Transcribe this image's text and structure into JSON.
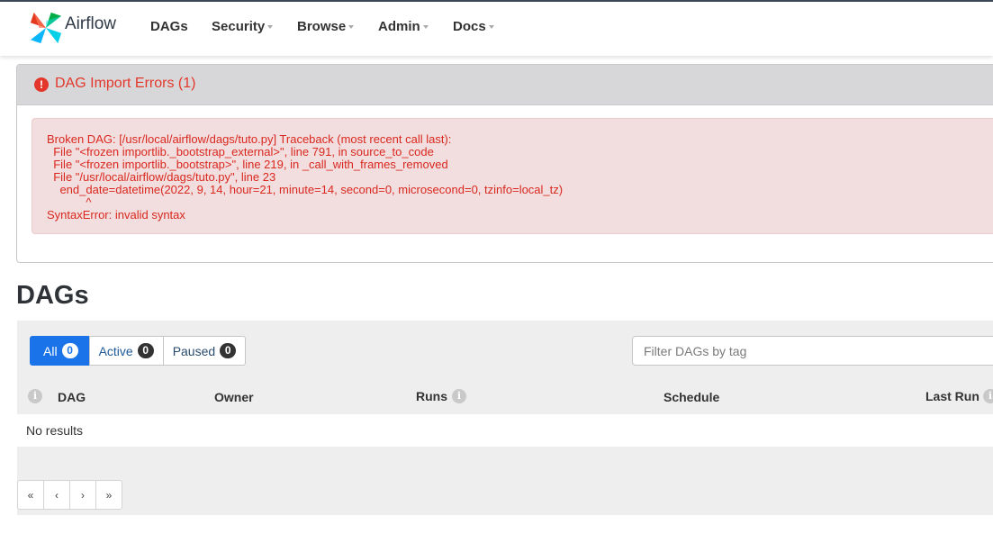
{
  "brand": {
    "name": "Airflow"
  },
  "nav": {
    "dags": "DAGs",
    "security": "Security",
    "browse": "Browse",
    "admin": "Admin",
    "docs": "Docs"
  },
  "import_errors": {
    "title": "DAG Import Errors (1)",
    "badge": "!",
    "message": "Broken DAG: [/usr/local/airflow/dags/tuto.py] Traceback (most recent call last):\n  File \"<frozen importlib._bootstrap_external>\", line 791, in source_to_code\n  File \"<frozen importlib._bootstrap>\", line 219, in _call_with_frames_removed\n  File \"/usr/local/airflow/dags/tuto.py\", line 23\n    end_date=datetime(2022, 9, 14, hour=21, minute=14, second=0, microsecond=0, tzinfo=local_tz)\n            ^\nSyntaxError: invalid syntax"
  },
  "page_title": "DAGs",
  "filters": {
    "all": {
      "label": "All",
      "count": "0"
    },
    "active": {
      "label": "Active",
      "count": "0"
    },
    "paused": {
      "label": "Paused",
      "count": "0"
    }
  },
  "tag_filter": {
    "placeholder": "Filter DAGs by tag"
  },
  "table": {
    "headers": {
      "dag": "DAG",
      "owner": "Owner",
      "runs": "Runs",
      "schedule": "Schedule",
      "last_run": "Last Run"
    },
    "info_glyph": "i",
    "empty_text": "No results"
  },
  "pagination": {
    "first": "«",
    "prev": "‹",
    "next": "›",
    "last": "»"
  },
  "colors": {
    "error_red": "#e4372b",
    "active_blue": "#1a73e8",
    "error_background": "#f2dede"
  }
}
